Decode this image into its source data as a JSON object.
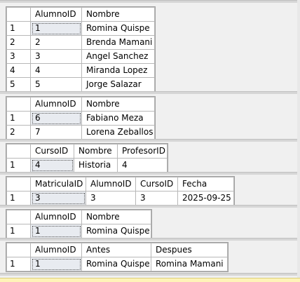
{
  "grids": [
    {
      "columns": [
        "AlumnoID",
        "Nombre"
      ],
      "rows": [
        {
          "n": "1",
          "cells": [
            "1",
            "Romina Quispe"
          ]
        },
        {
          "n": "2",
          "cells": [
            "2",
            "Brenda Mamani"
          ]
        },
        {
          "n": "3",
          "cells": [
            "3",
            "Angel Sanchez"
          ]
        },
        {
          "n": "4",
          "cells": [
            "4",
            "Miranda Lopez"
          ]
        },
        {
          "n": "5",
          "cells": [
            "5",
            "Jorge Salazar"
          ]
        }
      ]
    },
    {
      "columns": [
        "AlumnoID",
        "Nombre"
      ],
      "rows": [
        {
          "n": "1",
          "cells": [
            "6",
            "Fabiano Meza"
          ]
        },
        {
          "n": "2",
          "cells": [
            "7",
            "Lorena Zeballos"
          ]
        }
      ]
    },
    {
      "columns": [
        "CursoID",
        "Nombre",
        "ProfesorID"
      ],
      "rows": [
        {
          "n": "1",
          "cells": [
            "4",
            "Historia",
            "4"
          ]
        }
      ]
    },
    {
      "columns": [
        "MatriculaID",
        "AlumnoID",
        "CursoID",
        "Fecha"
      ],
      "rows": [
        {
          "n": "1",
          "cells": [
            "3",
            "3",
            "3",
            "2025-09-25"
          ]
        }
      ]
    },
    {
      "columns": [
        "AlumnoID",
        "Nombre"
      ],
      "rows": [
        {
          "n": "1",
          "cells": [
            "1",
            "Romina Quispe"
          ]
        }
      ]
    },
    {
      "columns": [
        "AlumnoID",
        "Antes",
        "Despues"
      ],
      "rows": [
        {
          "n": "1",
          "cells": [
            "1",
            "Romina Quispe",
            "Romina Mamani"
          ]
        }
      ]
    }
  ]
}
